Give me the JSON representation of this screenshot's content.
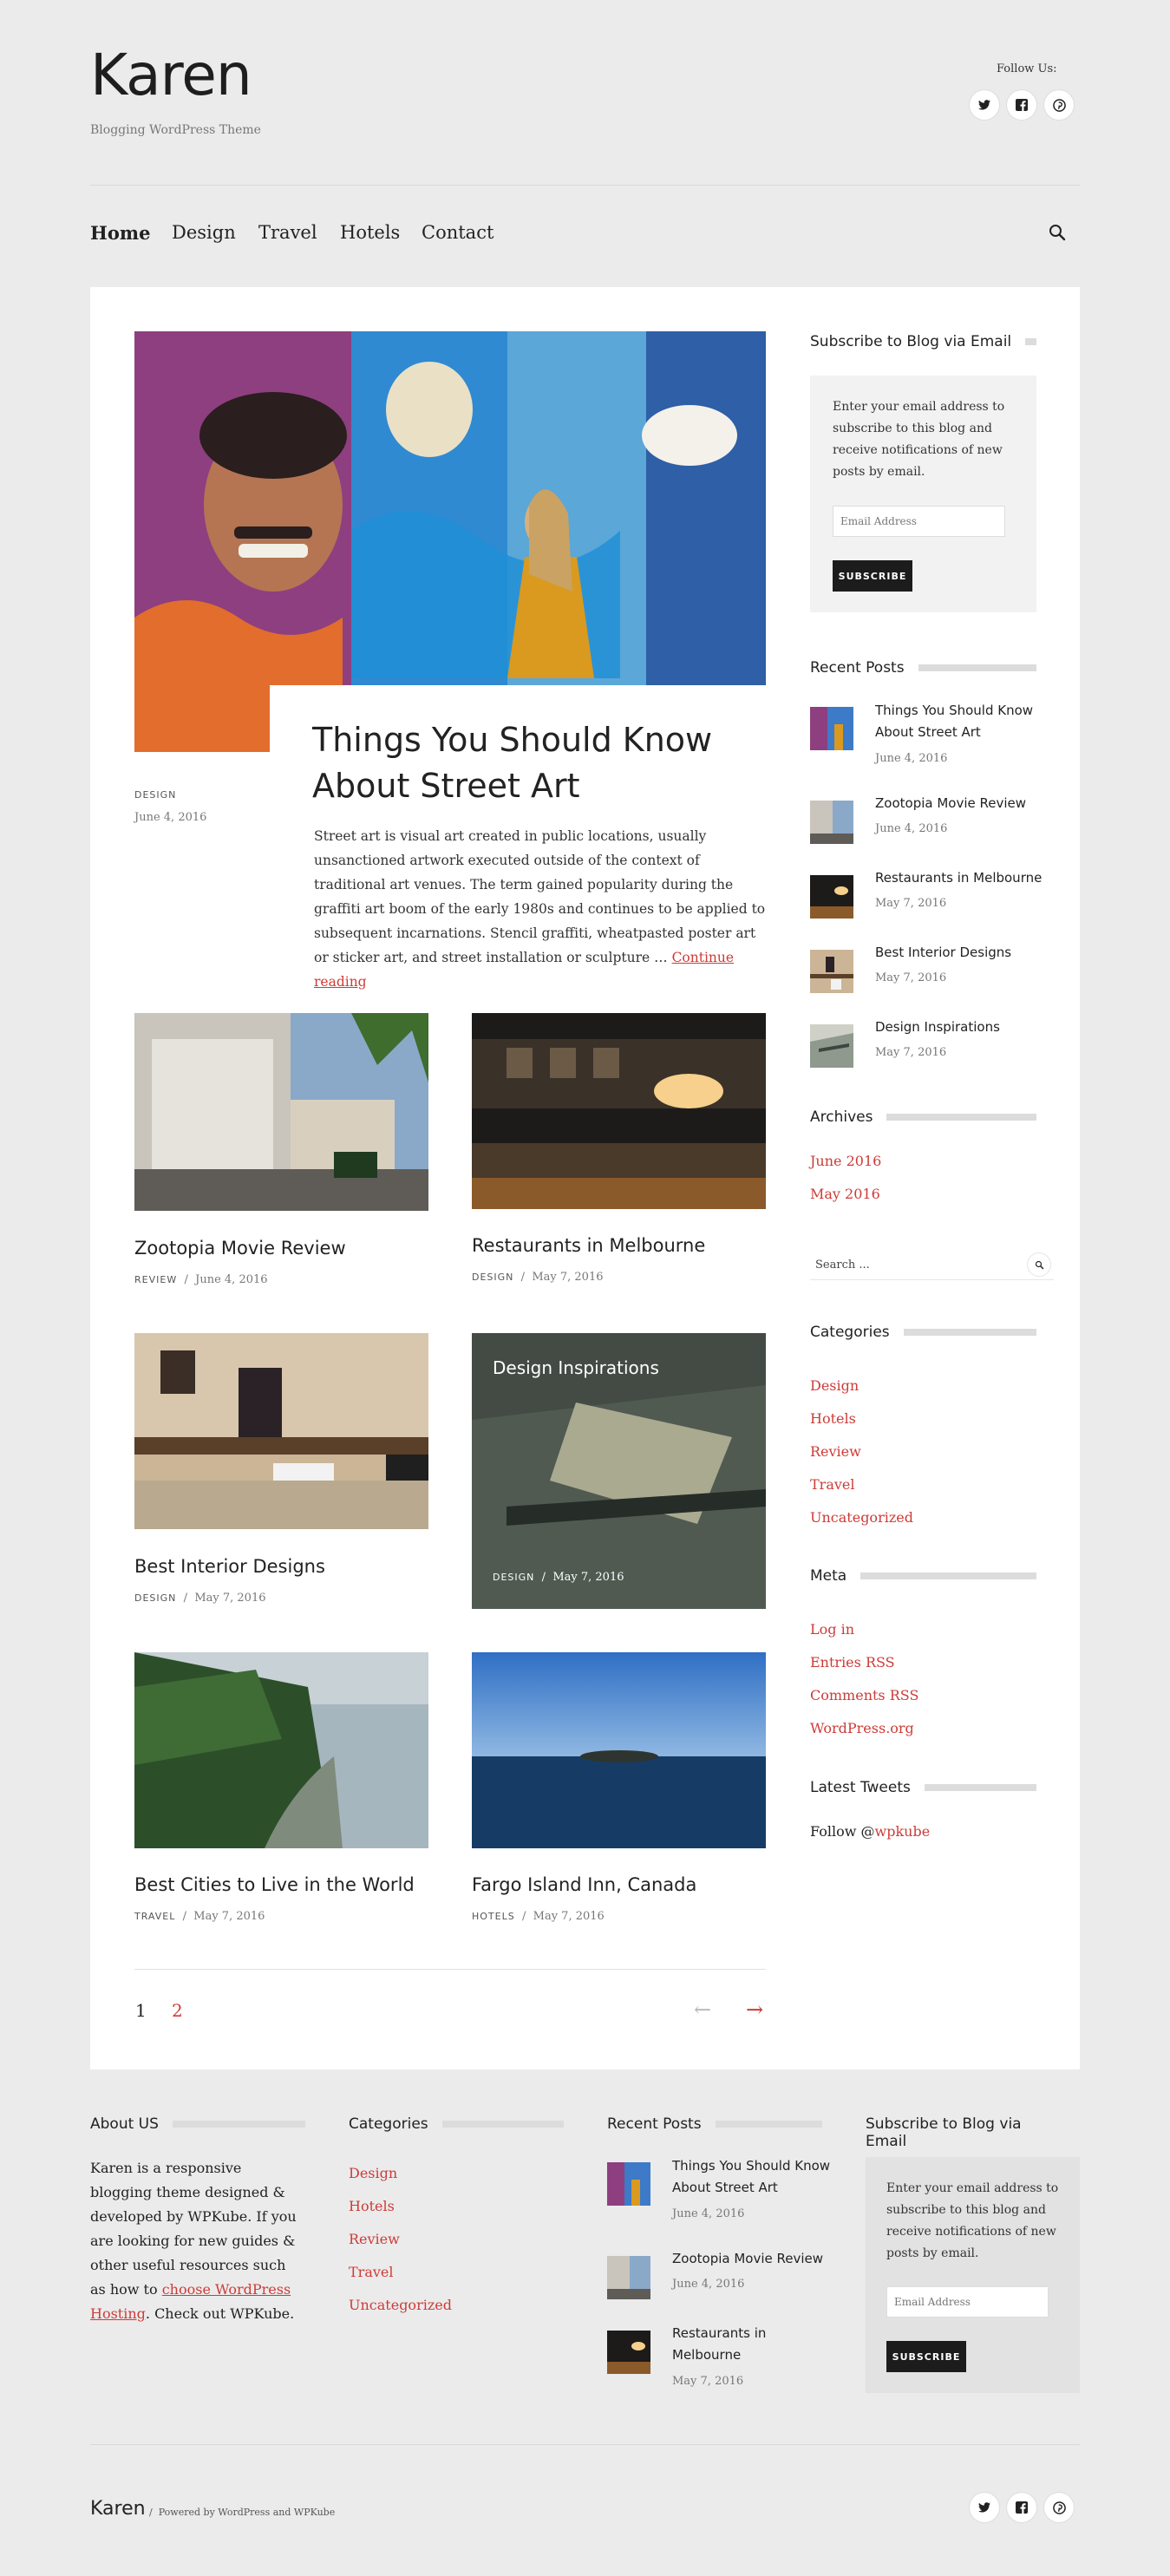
{
  "site": {
    "title": "Karen",
    "tagline": "Blogging WordPress Theme",
    "follow_label": "Follow Us:"
  },
  "colors": {
    "accent": "#cd3b37",
    "background": "#ebebeb",
    "panel": "#ffffff",
    "button": "#1c1c1c"
  },
  "social": [
    {
      "name": "twitter-icon",
      "glyph": "🐦"
    },
    {
      "name": "facebook-icon",
      "glyph": "f"
    },
    {
      "name": "pinterest-icon",
      "glyph": "P"
    }
  ],
  "nav": {
    "items": [
      "Home",
      "Design",
      "Travel",
      "Hotels",
      "Contact"
    ],
    "active": "Home"
  },
  "featured": {
    "title_line1": "Things You Should Know",
    "title_line2": "About Street Art",
    "category": "DESIGN",
    "date": "June 4, 2016",
    "excerpt": "Street art is visual art created in public locations, usually unsanctioned artwork executed outside of the context of traditional art venues. The term gained popularity during the graffiti art boom of the early 1980s and continues to be applied to subsequent incarnations. Stencil graffiti, wheatpasted poster art or sticker art, and street installation or sculpture …",
    "read_more": "Continue reading"
  },
  "posts": [
    {
      "title": "Zootopia Movie Review",
      "category": "REVIEW",
      "date": "June 4, 2016"
    },
    {
      "title": "Restaurants in Melbourne",
      "category": "DESIGN",
      "date": "May 7, 2016"
    },
    {
      "title": "Best Interior Designs",
      "category": "DESIGN",
      "date": "May 7, 2016"
    },
    {
      "title": "Design Inspirations",
      "category": "DESIGN",
      "date": "May 7, 2016"
    },
    {
      "title": "Best Cities to Live in the World",
      "category": "TRAVEL",
      "date": "May 7, 2016"
    },
    {
      "title": "Fargo Island Inn, Canada",
      "category": "HOTELS",
      "date": "May 7, 2016"
    }
  ],
  "pagination": {
    "pages": [
      "1",
      "2"
    ],
    "prev": "←",
    "next": "→"
  },
  "sidebar": {
    "subscribe": {
      "title": "Subscribe to Blog via Email",
      "text": "Enter your email address to subscribe to this blog and receive notifications of new posts by email.",
      "placeholder": "Email Address",
      "button": "SUBSCRIBE"
    },
    "recent": {
      "title": "Recent Posts",
      "items": [
        {
          "title_line1": "Things You Should Know",
          "title_line2": "About Street Art",
          "date": "June 4, 2016"
        },
        {
          "title_line1": "Zootopia Movie Review",
          "title_line2": "",
          "date": "June 4, 2016"
        },
        {
          "title_line1": "Restaurants in Melbourne",
          "title_line2": "",
          "date": "May 7, 2016"
        },
        {
          "title_line1": "Best Interior Designs",
          "title_line2": "",
          "date": "May 7, 2016"
        },
        {
          "title_line1": "Design Inspirations",
          "title_line2": "",
          "date": "May 7, 2016"
        }
      ]
    },
    "archives": {
      "title": "Archives",
      "items": [
        "June 2016",
        "May 2016"
      ]
    },
    "search": {
      "placeholder": "Search ..."
    },
    "categories": {
      "title": "Categories",
      "items": [
        "Design",
        "Hotels",
        "Review",
        "Travel",
        "Uncategorized"
      ]
    },
    "meta": {
      "title": "Meta",
      "items": [
        "Log in",
        "Entries RSS",
        "Comments RSS",
        "WordPress.org"
      ]
    },
    "tweets": {
      "title": "Latest Tweets",
      "follow_prefix": "Follow @",
      "handle": "wpkube"
    }
  },
  "footer": {
    "about": {
      "title": "About US",
      "text_before": "Karen is a responsive blogging theme designed & developed by WPKube. If you are looking for new guides & other useful resources such as how to ",
      "link": "choose WordPress Hosting",
      "text_after": ". Check out WPKube."
    },
    "categories": {
      "title": "Categories",
      "items": [
        "Design",
        "Hotels",
        "Review",
        "Travel",
        "Uncategorized"
      ]
    },
    "recent": {
      "title": "Recent Posts",
      "items": [
        {
          "title_line1": "Things You Should Know",
          "title_line2": "About Street Art",
          "date": "June 4, 2016"
        },
        {
          "title_line1": "Zootopia Movie Review",
          "title_line2": "",
          "date": "June 4, 2016"
        },
        {
          "title_line1": "Restaurants in",
          "title_line2": "Melbourne",
          "date": "May 7, 2016"
        }
      ]
    },
    "subscribe": {
      "title": "Subscribe to Blog via Email",
      "text": "Enter your email address to subscribe to this blog and receive notifications of new posts by email.",
      "placeholder": "Email Address",
      "button": "SUBSCRIBE"
    },
    "bottom": {
      "site": "Karen",
      "separator": "/",
      "credit": "Powered by WordPress and WPKube"
    }
  }
}
